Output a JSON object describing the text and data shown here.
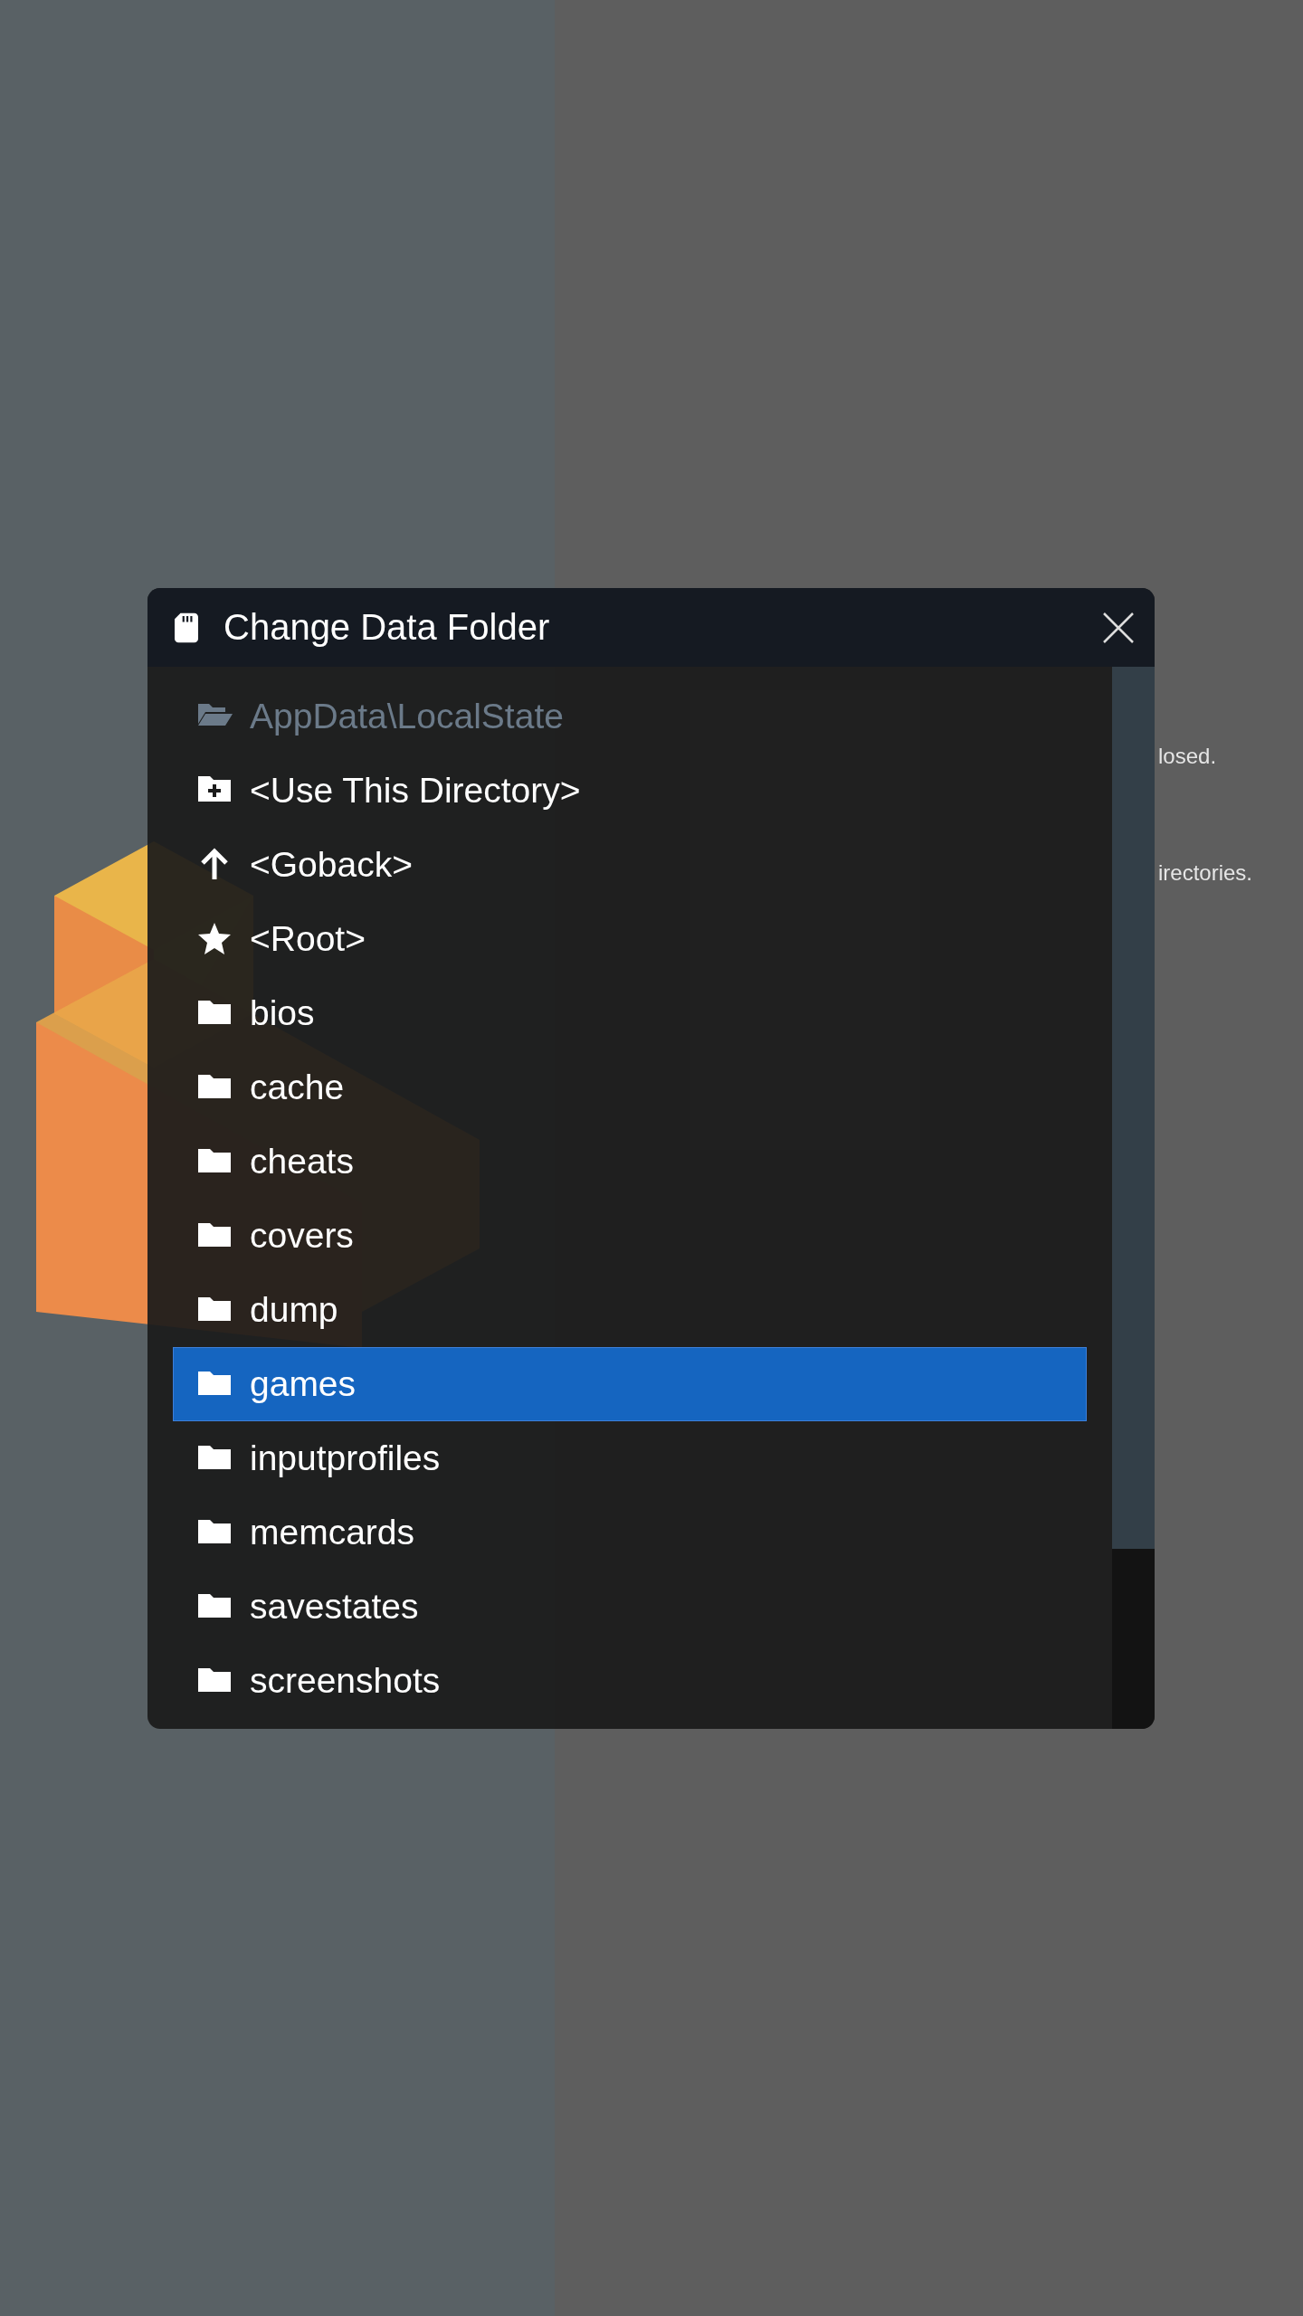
{
  "menu": {
    "items": [
      {
        "description": "losed."
      },
      {
        "description": "irectories."
      }
    ]
  },
  "dialog": {
    "title": "Change Data Folder",
    "entries": [
      {
        "kind": "path",
        "label": "AppData\\LocalState",
        "selected": false
      },
      {
        "kind": "use",
        "label": "<Use This Directory>",
        "selected": false
      },
      {
        "kind": "up",
        "label": "<Goback>",
        "selected": false
      },
      {
        "kind": "root",
        "label": "<Root>",
        "selected": false
      },
      {
        "kind": "folder",
        "label": "bios",
        "selected": false
      },
      {
        "kind": "folder",
        "label": "cache",
        "selected": false
      },
      {
        "kind": "folder",
        "label": "cheats",
        "selected": false
      },
      {
        "kind": "folder",
        "label": "covers",
        "selected": false
      },
      {
        "kind": "folder",
        "label": "dump",
        "selected": false
      },
      {
        "kind": "folder",
        "label": "games",
        "selected": true
      },
      {
        "kind": "folder",
        "label": "inputprofiles",
        "selected": false
      },
      {
        "kind": "folder",
        "label": "memcards",
        "selected": false
      },
      {
        "kind": "folder",
        "label": "savestates",
        "selected": false
      },
      {
        "kind": "folder",
        "label": "screenshots",
        "selected": false
      }
    ]
  }
}
